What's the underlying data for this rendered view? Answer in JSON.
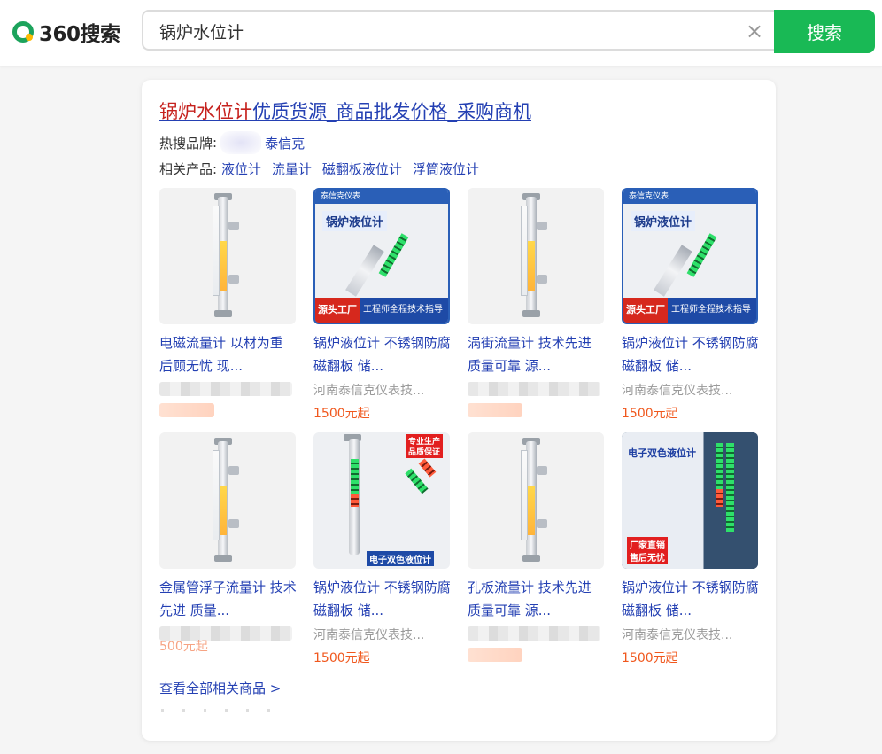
{
  "header": {
    "logo_text": "360搜索",
    "search_value": "锅炉水位计",
    "clear_glyph": "×",
    "search_button": "搜索"
  },
  "card": {
    "title_keyword": "锅炉水位计",
    "title_rest": "优质货源_商品批发价格_采购商机",
    "brands_label": "热搜品牌",
    "brands_colon": ":",
    "brand_link": "泰信克",
    "related_label": "相关产品:",
    "related": [
      "液位计",
      "流量计",
      "磁翻板液位计",
      "浮筒液位计"
    ],
    "view_all": "查看全部相关商品 >",
    "items": [
      {
        "title": "电磁流量计 以材为重 后顾无忧 现...",
        "shop": "",
        "price": ""
      },
      {
        "title": "锅炉液位计 不锈钢防腐磁翻板 储...",
        "shop": "河南泰信克仪表技...",
        "price": "1500元起"
      },
      {
        "title": "涡街流量计 技术先进 质量可靠 源...",
        "shop": "",
        "price": ""
      },
      {
        "title": "锅炉液位计 不锈钢防腐磁翻板 储...",
        "shop": "河南泰信克仪表技...",
        "price": "1500元起"
      },
      {
        "title": "金属管浮子流量计 技术先进 质量...",
        "shop": "",
        "price": "500元起"
      },
      {
        "title": "锅炉液位计 不锈钢防腐磁翻板 储...",
        "shop": "河南泰信克仪表技...",
        "price": "1500元起"
      },
      {
        "title": "孔板流量计 技术先进 质量可靠 源...",
        "shop": "",
        "price": ""
      },
      {
        "title": "锅炉液位计 不锈钢防腐磁翻板 储...",
        "shop": "河南泰信克仪表技...",
        "price": "1500元起"
      }
    ],
    "promo": {
      "brand_tag": "泰信克仪表",
      "product": "锅炉液位计",
      "factory": "源头工厂",
      "engineer": "工程师全程技术指导",
      "specialist": "专业生产",
      "quality": "品质保证",
      "dual_color": "电子双色液位计",
      "factory_direct": "厂家直销",
      "after_sale": "售后无忧"
    }
  },
  "colors": {
    "accent_green": "#19b955",
    "link_blue": "#2440b3",
    "keyword_red": "#c6221e",
    "price_orange": "#f0581e"
  }
}
